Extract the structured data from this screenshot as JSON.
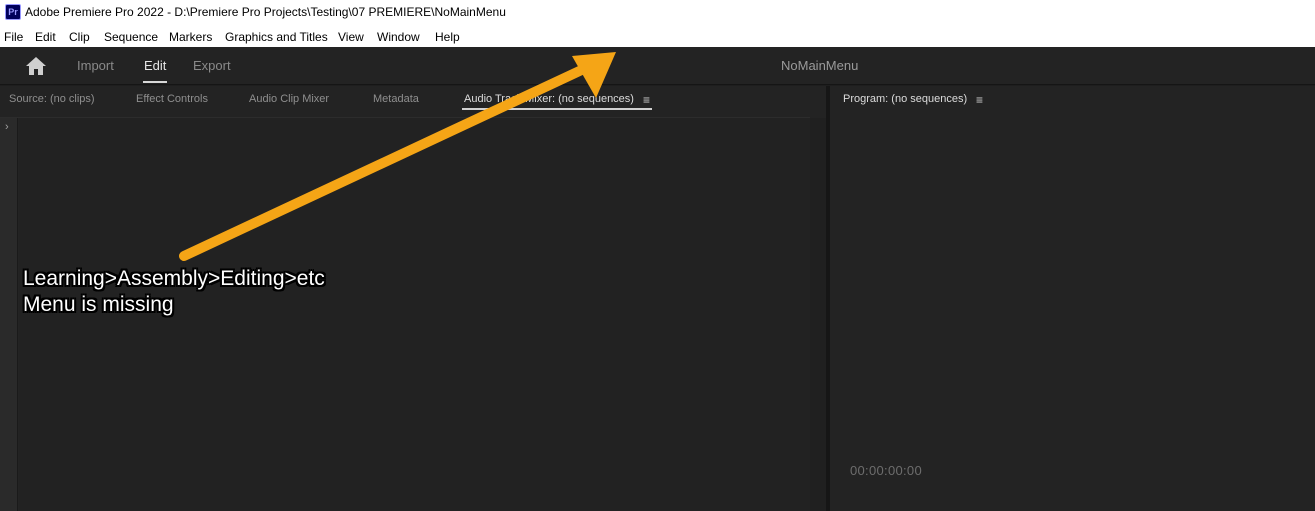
{
  "window": {
    "app_icon": "Pr",
    "title": "Adobe Premiere Pro 2022 - D:\\Premiere Pro Projects\\Testing\\07 PREMIERE\\NoMainMenu"
  },
  "menu": [
    "File",
    "Edit",
    "Clip",
    "Sequence",
    "Markers",
    "Graphics and Titles",
    "View",
    "Window",
    "Help"
  ],
  "header": {
    "home_icon": "home-icon",
    "tabs": [
      "Import",
      "Edit",
      "Export"
    ],
    "active_tab": "Edit",
    "project_name": "NoMainMenu"
  },
  "left_panel": {
    "tabs": [
      "Source: (no clips)",
      "Effect Controls",
      "Audio Clip Mixer",
      "Metadata",
      "Audio Track Mixer: (no sequences)"
    ],
    "active_tab": "Audio Track Mixer: (no sequences)",
    "menu_icon": "≡",
    "expand_icon": "›"
  },
  "program_monitor": {
    "tab": "Program: (no sequences)",
    "menu_icon": "≡",
    "timecode": "00:00:00:00"
  },
  "annotation": {
    "line1": "Learning>Assembly>Editing>etc",
    "line2": "Menu is missing",
    "arrow_color": "#f5a516"
  },
  "colors": {
    "panel_bg": "#232323",
    "titlebar_bg": "#ffffff",
    "accent_underline": "#d0d0d0"
  }
}
